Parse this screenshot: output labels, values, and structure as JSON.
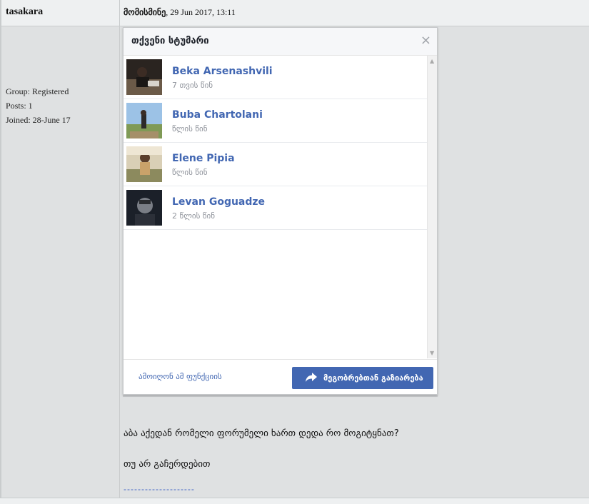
{
  "post": {
    "username": "tasakara",
    "date_label": "მომისმინე",
    "date_value": ", 29 Jun 2017, 13:11",
    "group": "Group: Registered",
    "posts": "Posts: 1",
    "joined": "Joined: 28-June 17",
    "line1": "აბა აქედან რომელი ფორუმელი ხართ დედა რო მოგიტყნათ?",
    "line2": "თუ არ გაჩერდებით",
    "dashes": "--------------------"
  },
  "popup": {
    "title": "თქვენი სტუმარი",
    "close": "×",
    "visitors": [
      {
        "name": "Beka Arsenashvili",
        "time": "7 თვის წინ"
      },
      {
        "name": "Buba Chartolani",
        "time": "წლის წინ"
      },
      {
        "name": "Elene Pipia",
        "time": "წლის წინ"
      },
      {
        "name": "Levan Goguadze",
        "time": "2 წლის წინ"
      }
    ],
    "turn_off": "ამოიღონ ამ ფუნქციის",
    "share": "მეგობრებთან გაზიარება"
  },
  "colors": {
    "accent": "#4267b2",
    "page_bg": "#dfe1e2"
  }
}
